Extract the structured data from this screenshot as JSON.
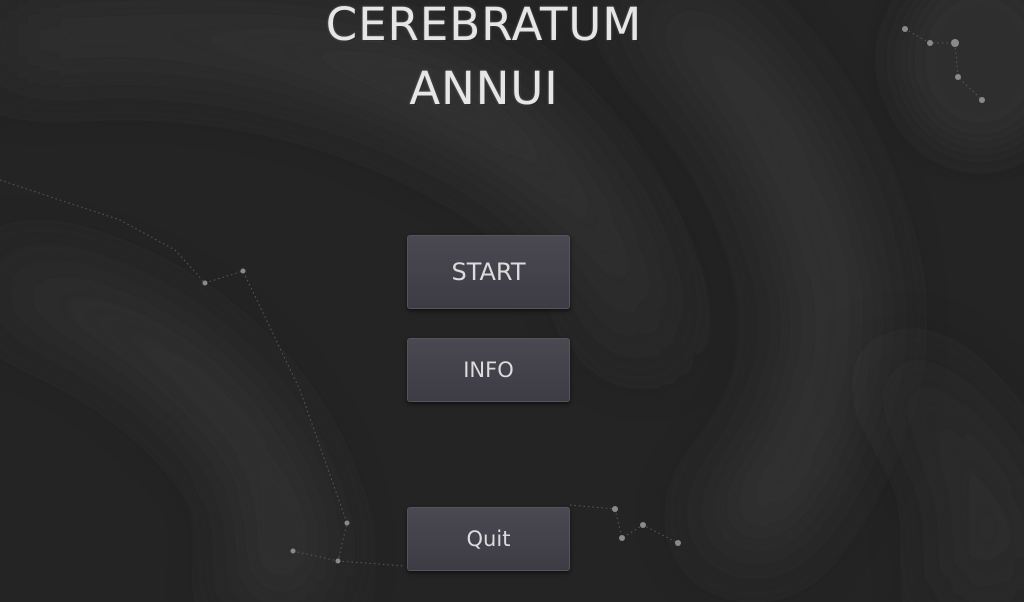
{
  "game": {
    "title_line_1": "CEREBRATUM",
    "title_line_2": "ANNUI"
  },
  "menu": {
    "start_label": "START",
    "info_label": "INFO",
    "quit_label": "Quit"
  },
  "colors": {
    "background": "#242424",
    "button_fill": "#46444c",
    "button_border": "#55535b",
    "text": "#dcdcdc"
  }
}
